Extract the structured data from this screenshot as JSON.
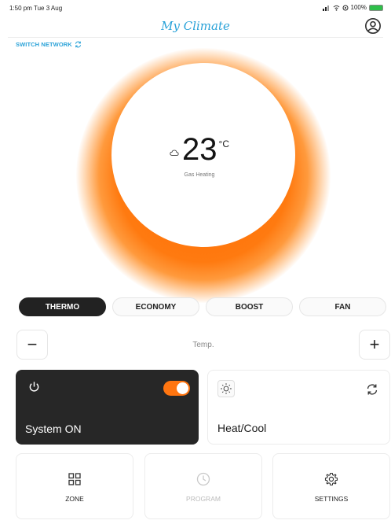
{
  "status_bar": {
    "time_date": "1:50 pm  Tue 3 Aug",
    "battery": "100%"
  },
  "header": {
    "title": "My Climate",
    "switch_network": "SWITCH NETWORK"
  },
  "dial": {
    "temperature": "23",
    "unit": "°C",
    "mode_caption": "Gas Heating"
  },
  "tabs": [
    {
      "label": "THERMO",
      "active": true
    },
    {
      "label": "ECONOMY",
      "active": false
    },
    {
      "label": "BOOST",
      "active": false
    },
    {
      "label": "FAN",
      "active": false
    }
  ],
  "stepper": {
    "minus": "−",
    "label": "Temp.",
    "plus": "+"
  },
  "cards": {
    "system": {
      "label": "System ON",
      "toggle_on": true
    },
    "heat_cool": {
      "label": "Heat/Cool"
    }
  },
  "nav": [
    {
      "label": "ZONE",
      "icon": "grid-icon",
      "enabled": true
    },
    {
      "label": "PROGRAM",
      "icon": "clock-icon",
      "enabled": false
    },
    {
      "label": "SETTINGS",
      "icon": "gear-icon",
      "enabled": true
    }
  ],
  "colors": {
    "accent": "#ff7510",
    "brand": "#2aa2d8",
    "dark_card": "#272727"
  }
}
